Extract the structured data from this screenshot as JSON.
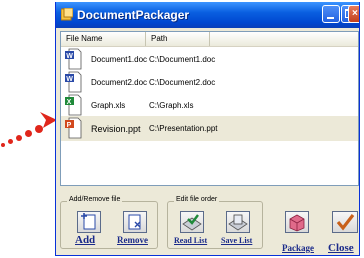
{
  "window": {
    "title": "DocumentPackager"
  },
  "file_list": {
    "columns": [
      "File Name",
      "Path"
    ],
    "rows": [
      {
        "name": "Document1.doc",
        "path": "C:\\Document1.doc",
        "type": "word-document-icon"
      },
      {
        "name": "Document2.doc",
        "path": "C:\\Document2.doc",
        "type": "word-document-icon"
      },
      {
        "name": "Graph.xls",
        "path": "C:\\Graph.xls",
        "type": "excel-document-icon"
      },
      {
        "name": "Revision.ppt",
        "path": "C:\\Presentation.ppt",
        "type": "powerpoint-document-icon",
        "selected": true
      }
    ]
  },
  "groups": {
    "add_remove": {
      "label": "Add/Remove file",
      "add": "Add",
      "remove": "Remove"
    },
    "edit_order": {
      "label": "Edit file order",
      "read_list": "Read List",
      "save_list": "Save List"
    }
  },
  "actions": {
    "package": "Package",
    "close": "Close"
  },
  "colors": {
    "titlebar": "#0a5fe0",
    "window_bg": "#ece9d8",
    "button_label": "#1a2a8a",
    "arrow": "#e0261b"
  }
}
